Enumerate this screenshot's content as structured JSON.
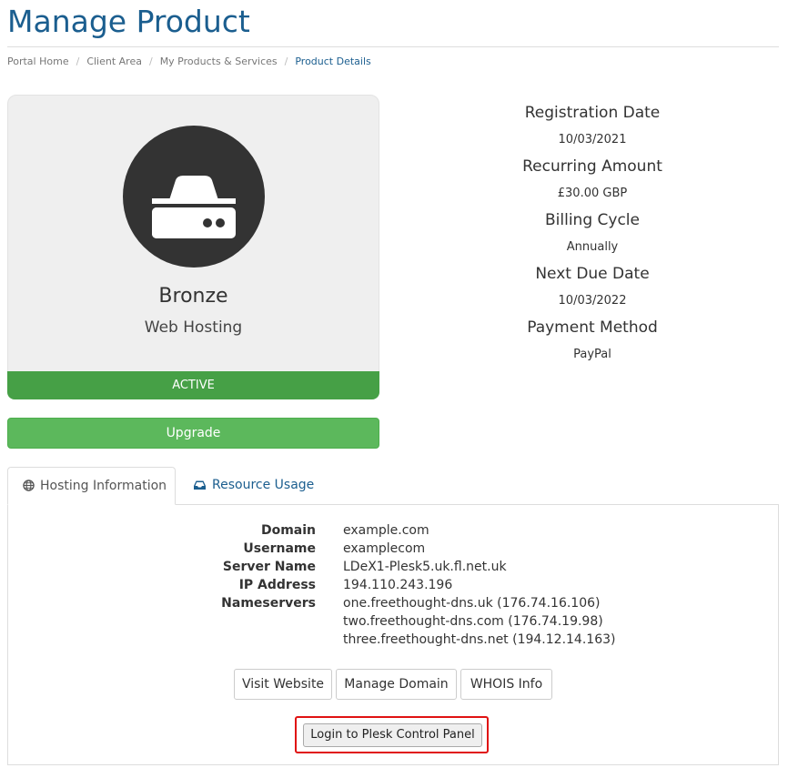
{
  "page": {
    "title": "Manage Product"
  },
  "breadcrumb": [
    "Portal Home",
    "Client Area",
    "My Products & Services",
    "Product Details"
  ],
  "product": {
    "icon": "hdd-server-icon",
    "name": "Bronze",
    "group": "Web Hosting",
    "status": "ACTIVE",
    "status_color": "#46a046"
  },
  "upgrade_label": "Upgrade",
  "billing": {
    "registration_date_label": "Registration Date",
    "registration_date": "10/03/2021",
    "recurring_amount_label": "Recurring Amount",
    "recurring_amount": "£30.00 GBP",
    "billing_cycle_label": "Billing Cycle",
    "billing_cycle": "Annually",
    "next_due_date_label": "Next Due Date",
    "next_due_date": "10/03/2022",
    "payment_method_label": "Payment Method",
    "payment_method": "PayPal"
  },
  "tabs": [
    {
      "label": "Hosting Information",
      "icon": "globe-icon",
      "active": true
    },
    {
      "label": "Resource Usage",
      "icon": "inbox-icon",
      "active": false
    }
  ],
  "hosting": {
    "domain_label": "Domain",
    "domain": "example.com",
    "username_label": "Username",
    "username": "examplecom",
    "server_name_label": "Server Name",
    "server_name": "LDeX1-Plesk5.uk.fl.net.uk",
    "ip_label": "IP Address",
    "ip": "194.110.243.196",
    "nameservers_label": "Nameservers",
    "nameservers": [
      "one.freethought-dns.uk (176.74.16.106)",
      "two.freethought-dns.com (176.74.19.98)",
      "three.freethought-dns.net (194.12.14.163)"
    ]
  },
  "actions": {
    "visit_website": "Visit Website",
    "manage_domain": "Manage Domain",
    "whois_info": "WHOIS Info",
    "login_panel": "Login to Plesk Control Panel"
  },
  "colors": {
    "brand": "#1b5e8f",
    "success": "#5cb85c",
    "highlight": "#e01212"
  }
}
